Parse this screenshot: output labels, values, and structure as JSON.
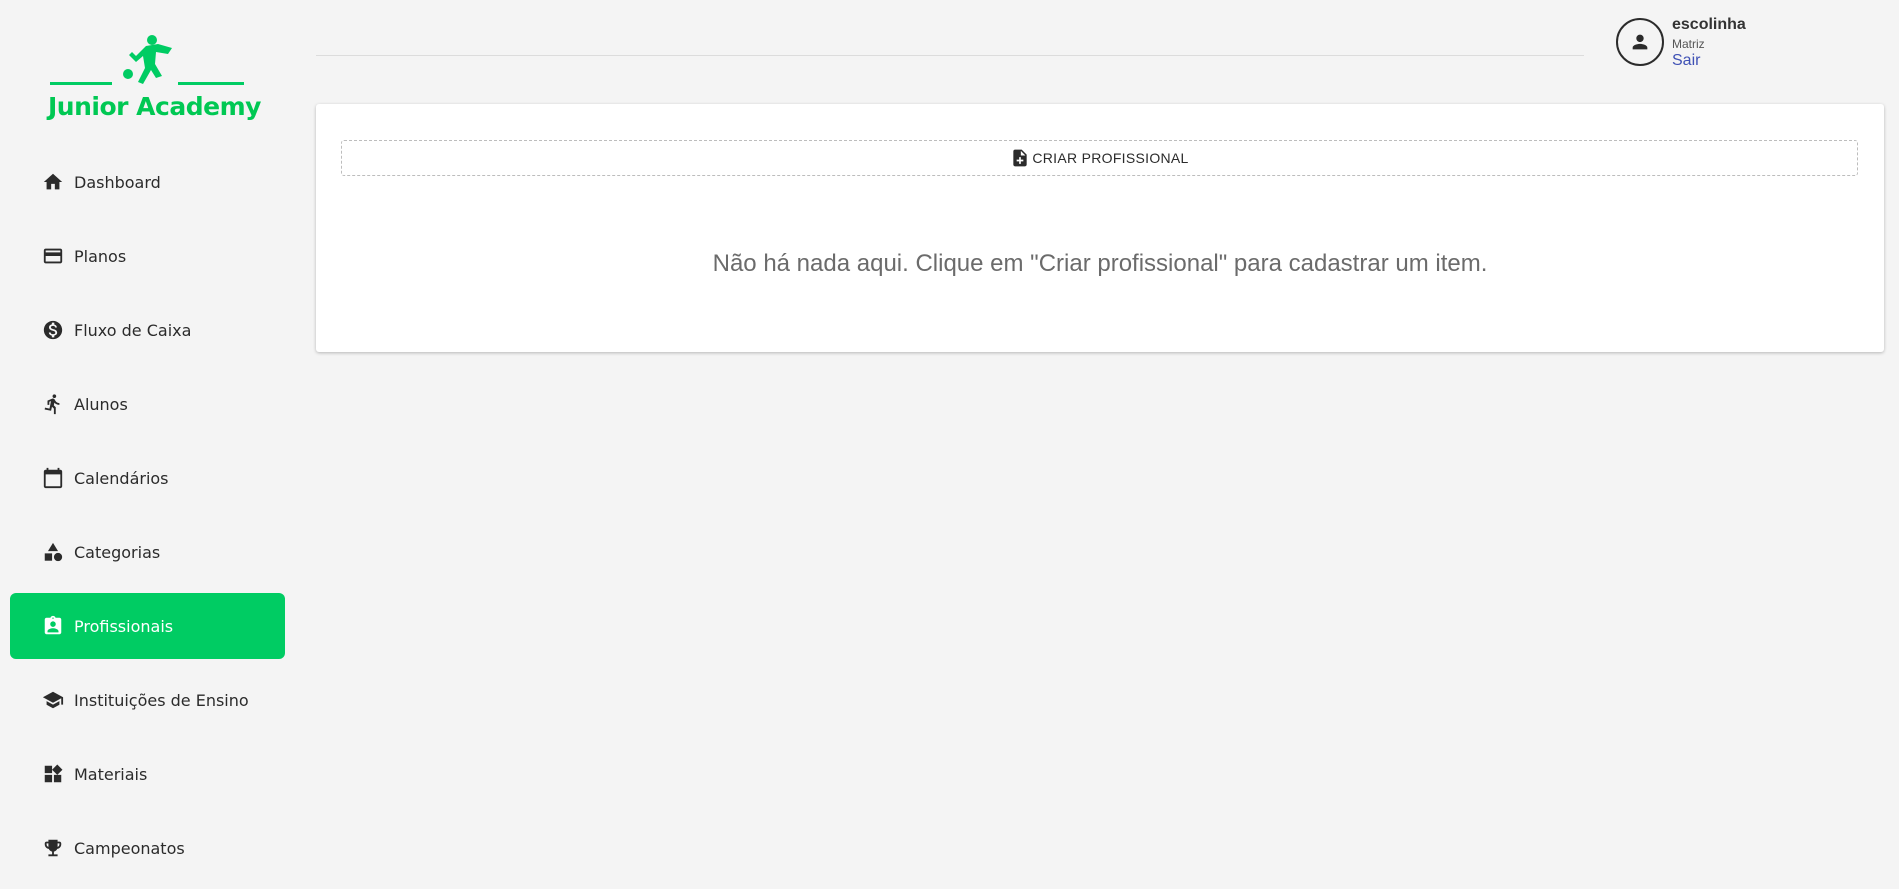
{
  "brand": {
    "name": "Junior Academy",
    "accent_color": "#00cc63"
  },
  "sidebar": {
    "items": [
      {
        "label": "Dashboard",
        "icon": "home-icon",
        "active": false
      },
      {
        "label": "Planos",
        "icon": "credit-card-icon",
        "active": false
      },
      {
        "label": "Fluxo de Caixa",
        "icon": "dollar-circle-icon",
        "active": false
      },
      {
        "label": "Alunos",
        "icon": "running-person-icon",
        "active": false
      },
      {
        "label": "Calendários",
        "icon": "calendar-icon",
        "active": false
      },
      {
        "label": "Categorias",
        "icon": "shapes-icon",
        "active": false
      },
      {
        "label": "Profissionais",
        "icon": "badge-icon",
        "active": true
      },
      {
        "label": "Instituições de Ensino",
        "icon": "graduation-cap-icon",
        "active": false
      },
      {
        "label": "Materiais",
        "icon": "widgets-icon",
        "active": false
      },
      {
        "label": "Campeonatos",
        "icon": "trophy-icon",
        "active": false
      }
    ]
  },
  "header": {
    "user": {
      "name": "escolinha",
      "branch": "Matriz",
      "logout_label": "Sair"
    }
  },
  "main": {
    "create_button_label": "CRIAR PROFISSIONAL",
    "empty_message": "Não há nada aqui. Clique em \"Criar profissional\" para cadastrar um item."
  }
}
